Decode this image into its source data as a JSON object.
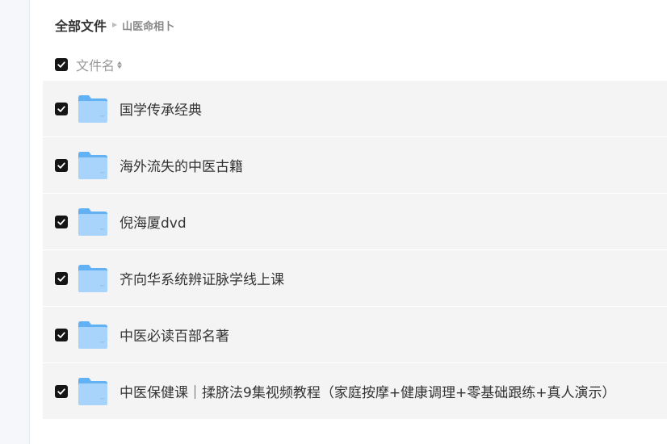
{
  "breadcrumb": {
    "root": "全部文件",
    "current": "山医命相卜"
  },
  "header": {
    "name_label": "文件名"
  },
  "files": [
    {
      "name": "国学传承经典",
      "checked": true
    },
    {
      "name": "海外流失的中医古籍",
      "checked": true
    },
    {
      "name": "倪海厦dvd",
      "checked": true
    },
    {
      "name": "齐向华系统辨证脉学线上课",
      "checked": true
    },
    {
      "name": "中医必读百部名著",
      "checked": true
    },
    {
      "name": "中医保健课｜揉脐法9集视频教程（家庭按摩+健康调理+零基础跟练+真人演示）",
      "checked": true
    }
  ],
  "colors": {
    "folder_light": "#a8d4fb",
    "folder_dark": "#62b1f5",
    "row_bg": "#f4f4f4",
    "checkbox": "#151515"
  }
}
